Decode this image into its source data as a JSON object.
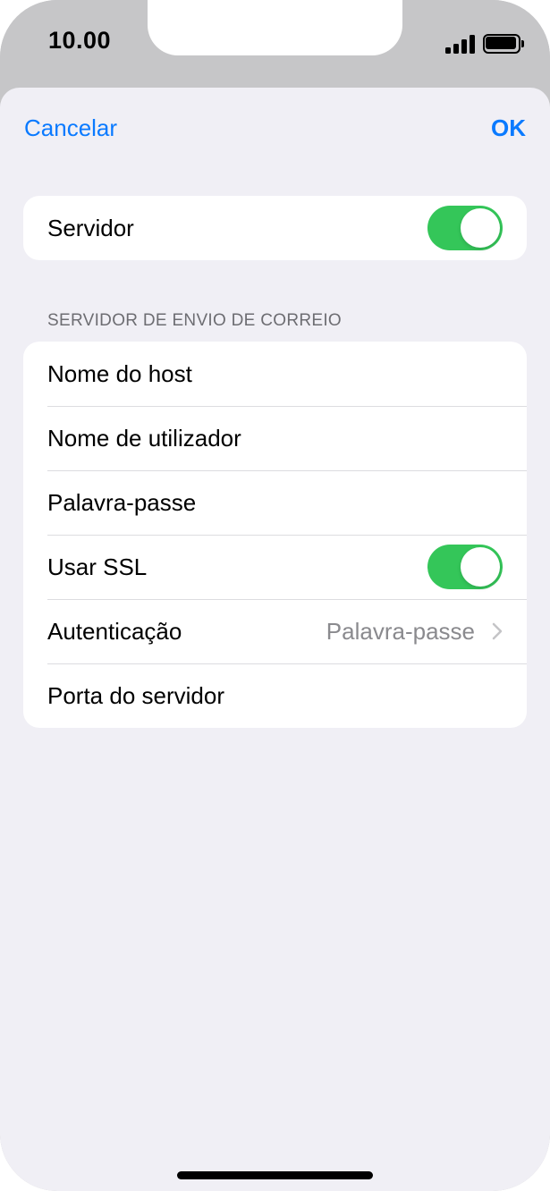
{
  "status_bar": {
    "time": "10.00",
    "icons": [
      "signal-icon",
      "battery-icon"
    ]
  },
  "nav": {
    "cancel_label": "Cancelar",
    "ok_label": "OK"
  },
  "server_group": {
    "server_label": "Servidor",
    "server_enabled": true
  },
  "outgoing_section": {
    "header": "SERVIDOR DE ENVIO DE CORREIO",
    "rows": [
      {
        "label": "Nome do host"
      },
      {
        "label": "Nome de utilizador"
      },
      {
        "label": "Palavra-passe"
      },
      {
        "label": "Usar SSL",
        "toggle": true
      },
      {
        "label": "Autenticação",
        "value": "Palavra-passe"
      },
      {
        "label": "Porta do servidor"
      }
    ]
  },
  "colors": {
    "accent": "#0a7aff",
    "toggle_on": "#34c659",
    "background": "#f0eff5",
    "secondary_text": "#8a8a8e"
  }
}
